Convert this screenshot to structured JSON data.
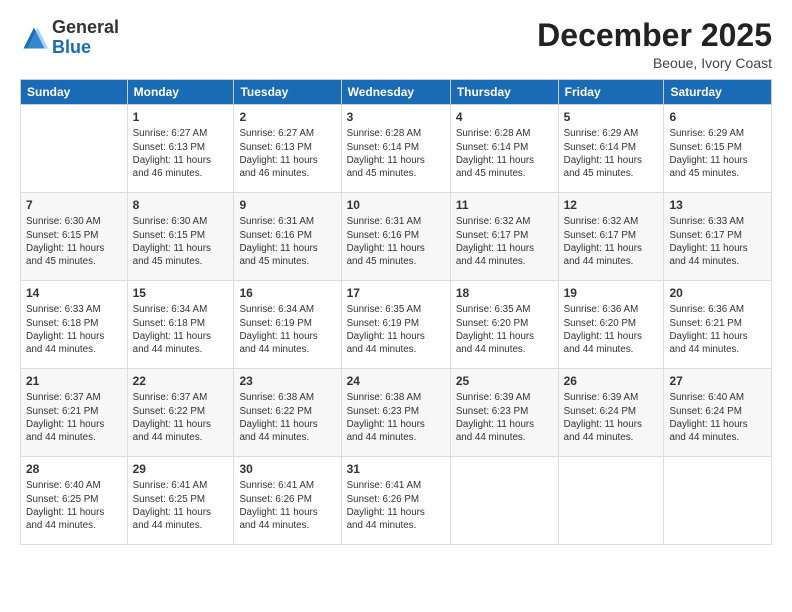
{
  "logo": {
    "general": "General",
    "blue": "Blue"
  },
  "title": "December 2025",
  "location": "Beoue, Ivory Coast",
  "days_header": [
    "Sunday",
    "Monday",
    "Tuesday",
    "Wednesday",
    "Thursday",
    "Friday",
    "Saturday"
  ],
  "weeks": [
    [
      {
        "day": "",
        "info": ""
      },
      {
        "day": "1",
        "info": "Sunrise: 6:27 AM\nSunset: 6:13 PM\nDaylight: 11 hours\nand 46 minutes."
      },
      {
        "day": "2",
        "info": "Sunrise: 6:27 AM\nSunset: 6:13 PM\nDaylight: 11 hours\nand 46 minutes."
      },
      {
        "day": "3",
        "info": "Sunrise: 6:28 AM\nSunset: 6:14 PM\nDaylight: 11 hours\nand 45 minutes."
      },
      {
        "day": "4",
        "info": "Sunrise: 6:28 AM\nSunset: 6:14 PM\nDaylight: 11 hours\nand 45 minutes."
      },
      {
        "day": "5",
        "info": "Sunrise: 6:29 AM\nSunset: 6:14 PM\nDaylight: 11 hours\nand 45 minutes."
      },
      {
        "day": "6",
        "info": "Sunrise: 6:29 AM\nSunset: 6:15 PM\nDaylight: 11 hours\nand 45 minutes."
      }
    ],
    [
      {
        "day": "7",
        "info": "Sunrise: 6:30 AM\nSunset: 6:15 PM\nDaylight: 11 hours\nand 45 minutes."
      },
      {
        "day": "8",
        "info": "Sunrise: 6:30 AM\nSunset: 6:15 PM\nDaylight: 11 hours\nand 45 minutes."
      },
      {
        "day": "9",
        "info": "Sunrise: 6:31 AM\nSunset: 6:16 PM\nDaylight: 11 hours\nand 45 minutes."
      },
      {
        "day": "10",
        "info": "Sunrise: 6:31 AM\nSunset: 6:16 PM\nDaylight: 11 hours\nand 45 minutes."
      },
      {
        "day": "11",
        "info": "Sunrise: 6:32 AM\nSunset: 6:17 PM\nDaylight: 11 hours\nand 44 minutes."
      },
      {
        "day": "12",
        "info": "Sunrise: 6:32 AM\nSunset: 6:17 PM\nDaylight: 11 hours\nand 44 minutes."
      },
      {
        "day": "13",
        "info": "Sunrise: 6:33 AM\nSunset: 6:17 PM\nDaylight: 11 hours\nand 44 minutes."
      }
    ],
    [
      {
        "day": "14",
        "info": "Sunrise: 6:33 AM\nSunset: 6:18 PM\nDaylight: 11 hours\nand 44 minutes."
      },
      {
        "day": "15",
        "info": "Sunrise: 6:34 AM\nSunset: 6:18 PM\nDaylight: 11 hours\nand 44 minutes."
      },
      {
        "day": "16",
        "info": "Sunrise: 6:34 AM\nSunset: 6:19 PM\nDaylight: 11 hours\nand 44 minutes."
      },
      {
        "day": "17",
        "info": "Sunrise: 6:35 AM\nSunset: 6:19 PM\nDaylight: 11 hours\nand 44 minutes."
      },
      {
        "day": "18",
        "info": "Sunrise: 6:35 AM\nSunset: 6:20 PM\nDaylight: 11 hours\nand 44 minutes."
      },
      {
        "day": "19",
        "info": "Sunrise: 6:36 AM\nSunset: 6:20 PM\nDaylight: 11 hours\nand 44 minutes."
      },
      {
        "day": "20",
        "info": "Sunrise: 6:36 AM\nSunset: 6:21 PM\nDaylight: 11 hours\nand 44 minutes."
      }
    ],
    [
      {
        "day": "21",
        "info": "Sunrise: 6:37 AM\nSunset: 6:21 PM\nDaylight: 11 hours\nand 44 minutes."
      },
      {
        "day": "22",
        "info": "Sunrise: 6:37 AM\nSunset: 6:22 PM\nDaylight: 11 hours\nand 44 minutes."
      },
      {
        "day": "23",
        "info": "Sunrise: 6:38 AM\nSunset: 6:22 PM\nDaylight: 11 hours\nand 44 minutes."
      },
      {
        "day": "24",
        "info": "Sunrise: 6:38 AM\nSunset: 6:23 PM\nDaylight: 11 hours\nand 44 minutes."
      },
      {
        "day": "25",
        "info": "Sunrise: 6:39 AM\nSunset: 6:23 PM\nDaylight: 11 hours\nand 44 minutes."
      },
      {
        "day": "26",
        "info": "Sunrise: 6:39 AM\nSunset: 6:24 PM\nDaylight: 11 hours\nand 44 minutes."
      },
      {
        "day": "27",
        "info": "Sunrise: 6:40 AM\nSunset: 6:24 PM\nDaylight: 11 hours\nand 44 minutes."
      }
    ],
    [
      {
        "day": "28",
        "info": "Sunrise: 6:40 AM\nSunset: 6:25 PM\nDaylight: 11 hours\nand 44 minutes."
      },
      {
        "day": "29",
        "info": "Sunrise: 6:41 AM\nSunset: 6:25 PM\nDaylight: 11 hours\nand 44 minutes."
      },
      {
        "day": "30",
        "info": "Sunrise: 6:41 AM\nSunset: 6:26 PM\nDaylight: 11 hours\nand 44 minutes."
      },
      {
        "day": "31",
        "info": "Sunrise: 6:41 AM\nSunset: 6:26 PM\nDaylight: 11 hours\nand 44 minutes."
      },
      {
        "day": "",
        "info": ""
      },
      {
        "day": "",
        "info": ""
      },
      {
        "day": "",
        "info": ""
      }
    ]
  ]
}
